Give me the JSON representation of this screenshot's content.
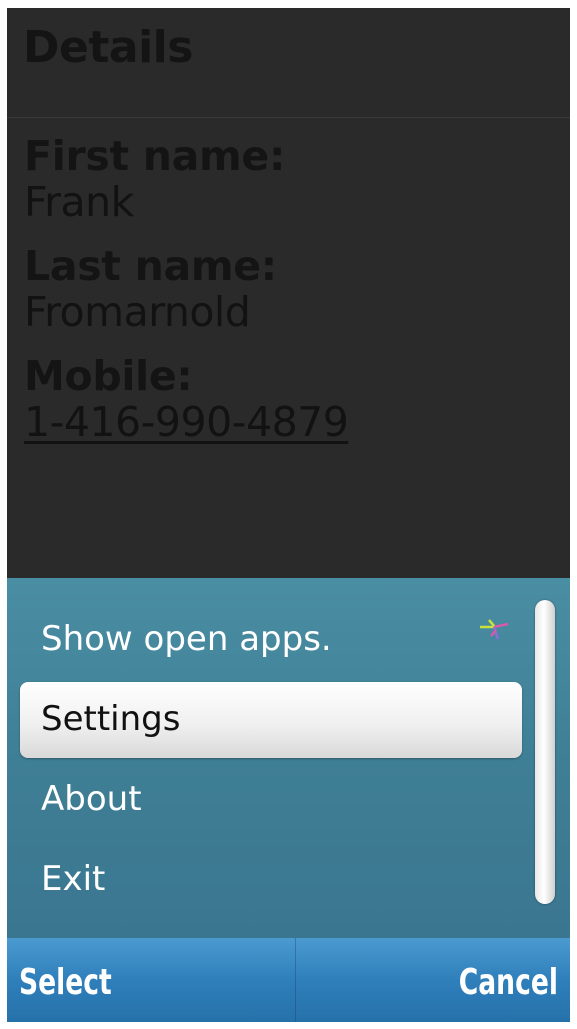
{
  "header": {
    "title": "Details"
  },
  "details": {
    "first_name_label": "First name:",
    "first_name_value": "Frank",
    "last_name_label": "Last name:",
    "last_name_value": "Fromarnold",
    "mobile_label": "Mobile:",
    "mobile_value": "1-416-990-4879"
  },
  "menu": {
    "items": [
      {
        "label": "Show open apps.",
        "icon": "task-swapper-icon",
        "selected": false
      },
      {
        "label": "Settings",
        "selected": true
      },
      {
        "label": "About",
        "selected": false
      },
      {
        "label": "Exit",
        "selected": false
      }
    ]
  },
  "softkeys": {
    "left_label": "Select",
    "right_label": "Cancel"
  },
  "colors": {
    "background": "#2a2a2a",
    "menu_background": "#4283a0",
    "softkey_background": "#2f7fbb",
    "selected_item": "#f0f0f0"
  }
}
